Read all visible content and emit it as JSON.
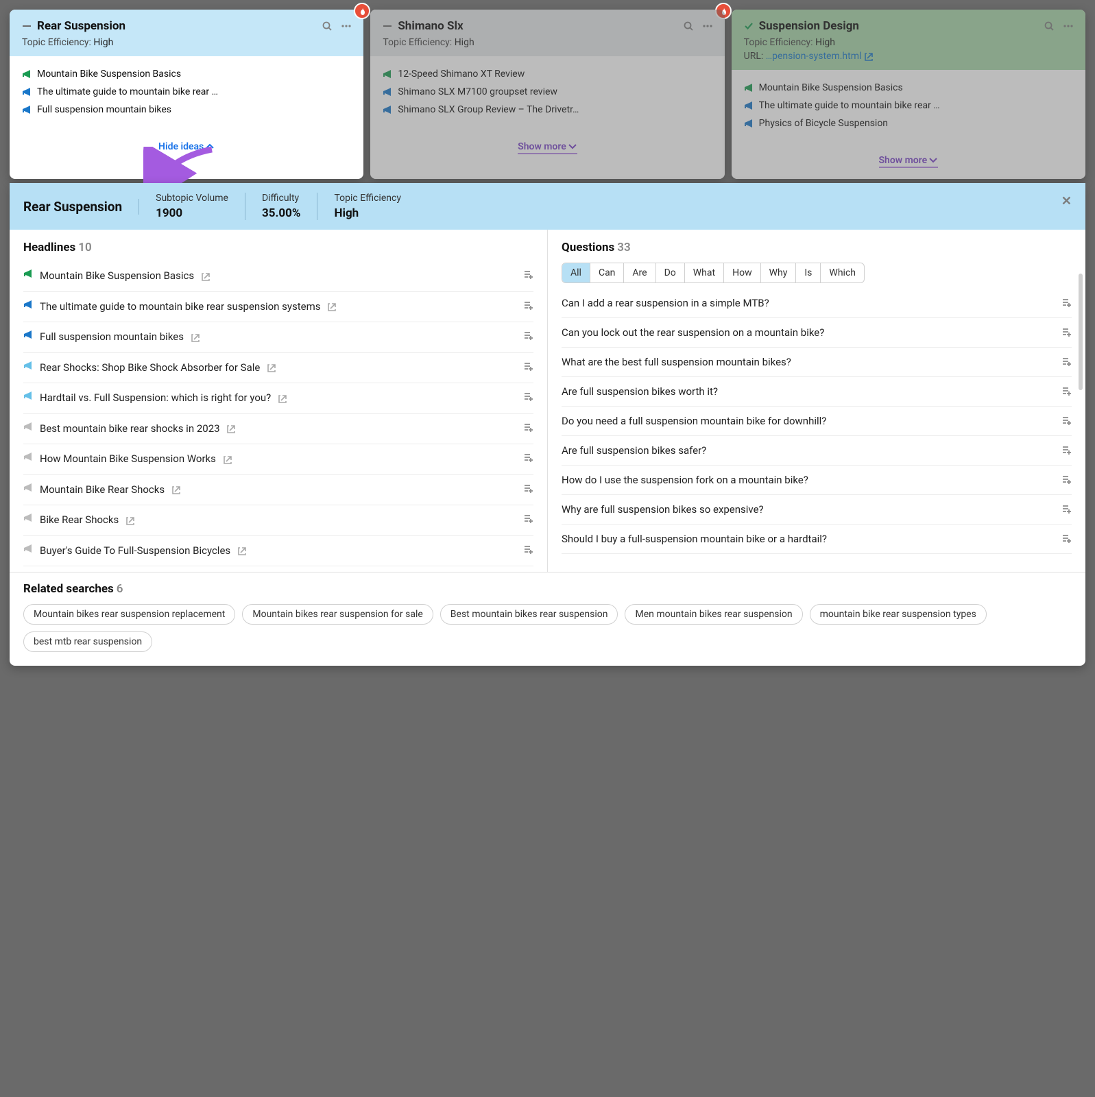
{
  "cards": [
    {
      "title": "Rear Suspension",
      "eff_label": "Topic Efficiency:",
      "eff_value": "High",
      "footer": "Hide ideas",
      "ideas": [
        {
          "text": "Mountain Bike Suspension Basics",
          "color": "green"
        },
        {
          "text": "The ultimate guide to mountain bike rear …",
          "color": "blue"
        },
        {
          "text": "Full suspension mountain bikes",
          "color": "blue"
        }
      ]
    },
    {
      "title": "Shimano Slx",
      "eff_label": "Topic Efficiency:",
      "eff_value": "High",
      "footer": "Show more",
      "ideas": [
        {
          "text": "12-Speed Shimano XT Review",
          "color": "green"
        },
        {
          "text": "Shimano SLX M7100 groupset review",
          "color": "blue"
        },
        {
          "text": "Shimano SLX Group Review – The Drivetr…",
          "color": "blue"
        }
      ]
    },
    {
      "title": "Suspension Design",
      "eff_label": "Topic Efficiency:",
      "eff_value": "High",
      "url_label": "URL:",
      "url_value": "…pension-system.html",
      "footer": "Show more",
      "ideas": [
        {
          "text": "Mountain Bike Suspension Basics",
          "color": "green"
        },
        {
          "text": "The ultimate guide to mountain bike rear …",
          "color": "blue"
        },
        {
          "text": "Physics of Bicycle Suspension",
          "color": "blue"
        }
      ]
    }
  ],
  "detail": {
    "title": "Rear Suspension",
    "sub_label": "Subtopic Volume",
    "sub_value": "1900",
    "diff_label": "Difficulty",
    "diff_value": "35.00%",
    "eff_label": "Topic Efficiency",
    "eff_value": "High",
    "headlines_label": "Headlines",
    "headlines_count": "10",
    "questions_label": "Questions",
    "questions_count": "33",
    "tabs": [
      "All",
      "Can",
      "Are",
      "Do",
      "What",
      "How",
      "Why",
      "Is",
      "Which"
    ],
    "headlines": [
      {
        "text": "Mountain Bike Suspension Basics",
        "color": "green",
        "ext": true
      },
      {
        "text": "The ultimate guide to mountain bike rear suspension systems",
        "color": "blue",
        "ext": true,
        "multi": true
      },
      {
        "text": "Full suspension mountain bikes",
        "color": "blue",
        "ext": true
      },
      {
        "text": "Rear Shocks: Shop Bike Shock Absorber for Sale",
        "color": "light",
        "ext": true
      },
      {
        "text": "Hardtail vs. Full Suspension: which is right for you?",
        "color": "light",
        "ext": true
      },
      {
        "text": "Best mountain bike rear shocks in 2023",
        "color": "gray",
        "ext": true
      },
      {
        "text": "How Mountain Bike Suspension Works",
        "color": "gray",
        "ext": true
      },
      {
        "text": "Mountain Bike Rear Shocks",
        "color": "gray",
        "ext": true
      },
      {
        "text": "Bike Rear Shocks",
        "color": "gray",
        "ext": true
      },
      {
        "text": "Buyer's Guide To Full-Suspension Bicycles",
        "color": "gray",
        "ext": true
      }
    ],
    "questions": [
      "Can I add a rear suspension in a simple MTB?",
      "Can you lock out the rear suspension on a mountain bike?",
      "What are the best full suspension mountain bikes?",
      "Are full suspension bikes worth it?",
      "Do you need a full suspension mountain bike for downhill?",
      "Are full suspension bikes safer?",
      "How do I use the suspension fork on a mountain bike?",
      "Why are full suspension bikes so expensive?",
      "Should I buy a full-suspension mountain bike or a hardtail?"
    ],
    "related_label": "Related searches",
    "related_count": "6",
    "related": [
      "Mountain bikes rear suspension replacement",
      "Mountain bikes rear suspension for sale",
      "Best mountain bikes rear suspension",
      "Men mountain bikes rear suspension",
      "mountain bike rear suspension types",
      "best mtb rear suspension"
    ]
  }
}
